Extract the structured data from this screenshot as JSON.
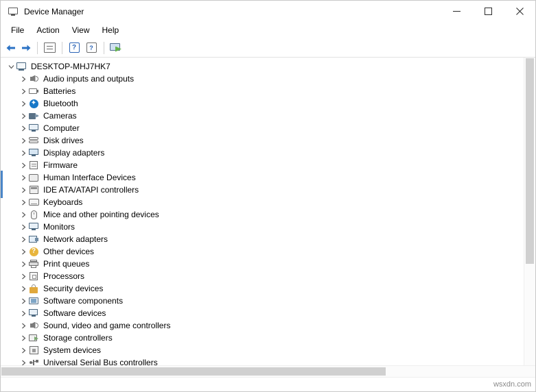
{
  "window": {
    "title": "Device Manager",
    "icon": "device-manager-icon",
    "controls": {
      "minimize": "–",
      "maximize": "□",
      "close": "✕"
    }
  },
  "menubar": {
    "items": [
      {
        "label": "File"
      },
      {
        "label": "Action"
      },
      {
        "label": "View"
      },
      {
        "label": "Help"
      }
    ]
  },
  "toolbar": {
    "buttons": [
      {
        "name": "back-button",
        "icon": "arrow-left-icon"
      },
      {
        "name": "forward-button",
        "icon": "arrow-right-icon"
      },
      {
        "name": "show-hide-console-tree-button",
        "icon": "tree-panel-icon"
      },
      {
        "name": "help-button",
        "icon": "question-mark-icon"
      },
      {
        "name": "properties-help-button",
        "icon": "properties-icon"
      },
      {
        "name": "scan-hardware-changes-button",
        "icon": "scan-monitor-icon"
      }
    ]
  },
  "tree": {
    "root": {
      "label": "DESKTOP-MHJ7HK7",
      "icon": "computer-icon",
      "expanded": true
    },
    "nodes": [
      {
        "label": "Audio inputs and outputs",
        "icon": "speaker-icon"
      },
      {
        "label": "Batteries",
        "icon": "battery-icon"
      },
      {
        "label": "Bluetooth",
        "icon": "bluetooth-icon"
      },
      {
        "label": "Cameras",
        "icon": "camera-icon"
      },
      {
        "label": "Computer",
        "icon": "computer-icon"
      },
      {
        "label": "Disk drives",
        "icon": "disk-drive-icon"
      },
      {
        "label": "Display adapters",
        "icon": "display-adapter-icon"
      },
      {
        "label": "Firmware",
        "icon": "firmware-icon"
      },
      {
        "label": "Human Interface Devices",
        "icon": "hid-icon"
      },
      {
        "label": "IDE ATA/ATAPI controllers",
        "icon": "ide-controller-icon"
      },
      {
        "label": "Keyboards",
        "icon": "keyboard-icon"
      },
      {
        "label": "Mice and other pointing devices",
        "icon": "mouse-icon"
      },
      {
        "label": "Monitors",
        "icon": "monitor-icon"
      },
      {
        "label": "Network adapters",
        "icon": "network-adapter-icon"
      },
      {
        "label": "Other devices",
        "icon": "warning-icon"
      },
      {
        "label": "Print queues",
        "icon": "printer-icon"
      },
      {
        "label": "Processors",
        "icon": "processor-icon"
      },
      {
        "label": "Security devices",
        "icon": "security-lock-icon"
      },
      {
        "label": "Software components",
        "icon": "software-component-icon"
      },
      {
        "label": "Software devices",
        "icon": "software-device-icon"
      },
      {
        "label": "Sound, video and game controllers",
        "icon": "sound-controller-icon",
        "highlighted": true
      },
      {
        "label": "Storage controllers",
        "icon": "storage-controller-icon"
      },
      {
        "label": "System devices",
        "icon": "system-device-icon"
      },
      {
        "label": "Universal Serial Bus controllers",
        "icon": "usb-controller-icon"
      }
    ]
  },
  "highlight": {
    "color": "#e23b2e",
    "target": "Sound, video and game controllers"
  },
  "statusbar": {
    "watermark": "wsxdn.com"
  }
}
